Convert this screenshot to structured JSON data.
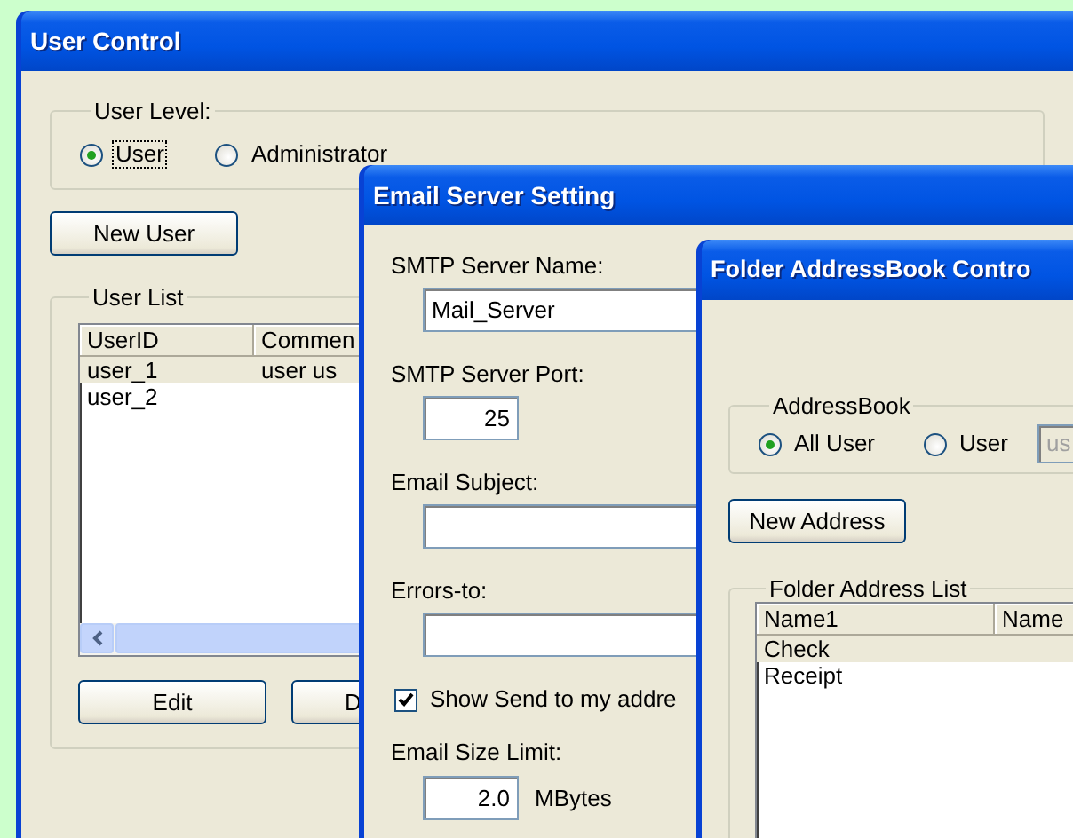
{
  "user_control": {
    "title": "User Control",
    "user_level": {
      "legend": "User Level:",
      "options": [
        {
          "label": "User",
          "selected": true,
          "focused": true
        },
        {
          "label": "Administrator",
          "selected": false,
          "focused": false
        }
      ]
    },
    "new_user_button": {
      "label": "New User"
    },
    "user_list": {
      "legend": "User List",
      "columns": [
        "UserID",
        "Commen"
      ],
      "rows": [
        {
          "cells": [
            "user_1",
            "user us"
          ],
          "selected": true
        },
        {
          "cells": [
            "user_2"
          ],
          "selected": false
        }
      ]
    },
    "buttons": [
      {
        "label": "Edit"
      },
      {
        "label": "D"
      }
    ]
  },
  "email_server_setting": {
    "title": "Email Server Setting",
    "fields": [
      {
        "label": "SMTP Server Name:",
        "kind": "wide",
        "value": "Mail_Server"
      },
      {
        "label": "SMTP Server Port:",
        "kind": "short",
        "value": "25"
      },
      {
        "label": "Email Subject:",
        "kind": "wide"
      },
      {
        "label": "Errors-to:",
        "kind": "wide"
      }
    ],
    "checkbox": {
      "label": "Show Send to my addre",
      "checked": true
    },
    "size_limit": {
      "label": "Email Size Limit:",
      "value": "2.0",
      "unit": "MBytes"
    }
  },
  "folder_addressbook_control": {
    "title": "Folder AddressBook Contro",
    "addressbook": {
      "legend": "AddressBook",
      "options": [
        {
          "label": "All User",
          "selected": true,
          "focused": false
        },
        {
          "label": "User",
          "selected": false,
          "focused": false
        }
      ],
      "user_field": {
        "value": "us",
        "disabled": true
      }
    },
    "new_address_button": {
      "label": "New Address"
    },
    "address_list": {
      "legend": "Folder Address List",
      "columns": [
        "Name1",
        "Name"
      ],
      "rows": [
        {
          "cells": [
            "Check"
          ],
          "selected": true
        },
        {
          "cells": [
            "Receipt"
          ],
          "selected": false
        }
      ]
    }
  }
}
